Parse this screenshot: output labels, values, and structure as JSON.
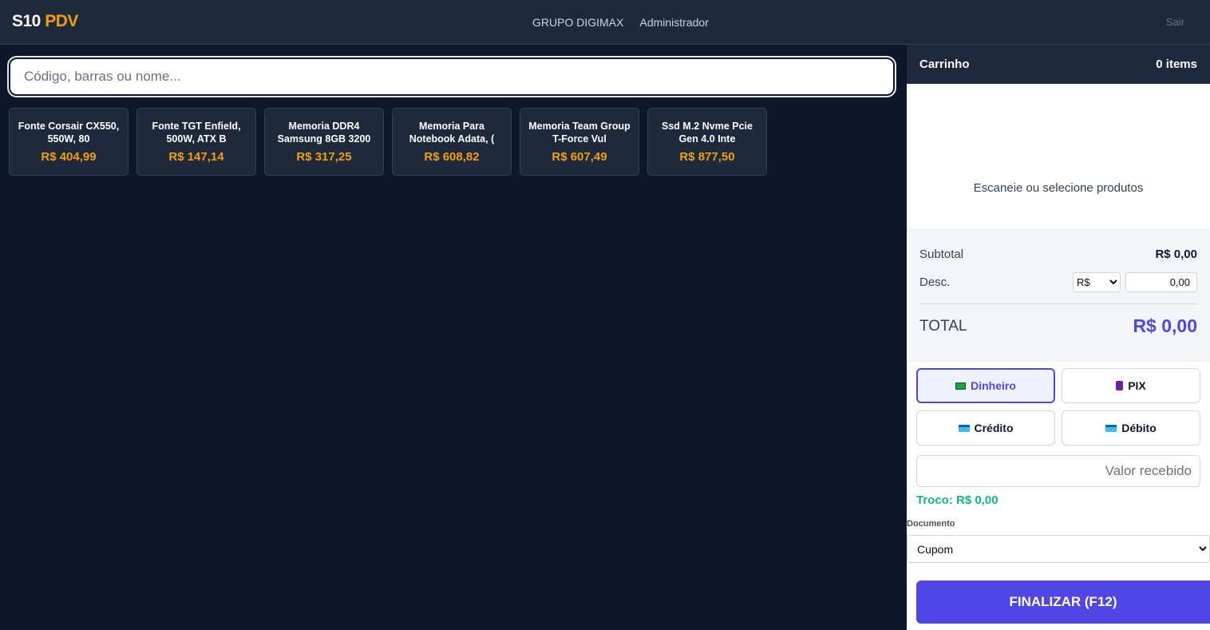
{
  "header": {
    "logo_main": "S10",
    "logo_accent": "PDV",
    "company": "GRUPO DIGIMAX",
    "user": "Administrador",
    "logout_label": "Sair"
  },
  "search": {
    "placeholder": "Código, barras ou nome..."
  },
  "products": [
    {
      "name": "Fonte Corsair CX550, 550W, 80",
      "price": "R$ 404,99"
    },
    {
      "name": "Fonte TGT Enfield, 500W, ATX B",
      "price": "R$ 147,14"
    },
    {
      "name": "Memoria DDR4 Samsung 8GB 3200",
      "price": "R$ 317,25"
    },
    {
      "name": "Memoria Para Notebook Adata, (",
      "price": "R$ 608,82"
    },
    {
      "name": "Memoria Team Group T-Force Vul",
      "price": "R$ 607,49"
    },
    {
      "name": "Ssd M.2 Nvme Pcie Gen 4.0 Inte",
      "price": "R$ 877,50"
    }
  ],
  "cart": {
    "title": "Carrinho",
    "count": "0 items",
    "empty_message": "Escaneie ou selecione produtos",
    "subtotal_label": "Subtotal",
    "subtotal_value": "R$ 0,00",
    "discount_label": "Desc.",
    "discount_type": "R$",
    "discount_value": "0,00",
    "total_label": "TOTAL",
    "total_value": "R$ 0,00"
  },
  "payment": {
    "methods": [
      {
        "label": "Dinheiro",
        "icon": "cash-icon",
        "selected": true
      },
      {
        "label": "PIX",
        "icon": "phone-icon",
        "selected": false
      },
      {
        "label": "Crédito",
        "icon": "credit-card-icon",
        "selected": false
      },
      {
        "label": "Débito",
        "icon": "debit-card-icon",
        "selected": false
      }
    ],
    "received_placeholder": "Valor recebido",
    "change_text": "Troco: R$ 0,00"
  },
  "document": {
    "label": "Documento",
    "selected": "Cupom"
  },
  "finish_label": "FINALIZAR (F12)",
  "colors": {
    "accent": "#f59e0b",
    "primary": "#4f46e5",
    "success": "#10b981",
    "background": "#0f172a"
  }
}
